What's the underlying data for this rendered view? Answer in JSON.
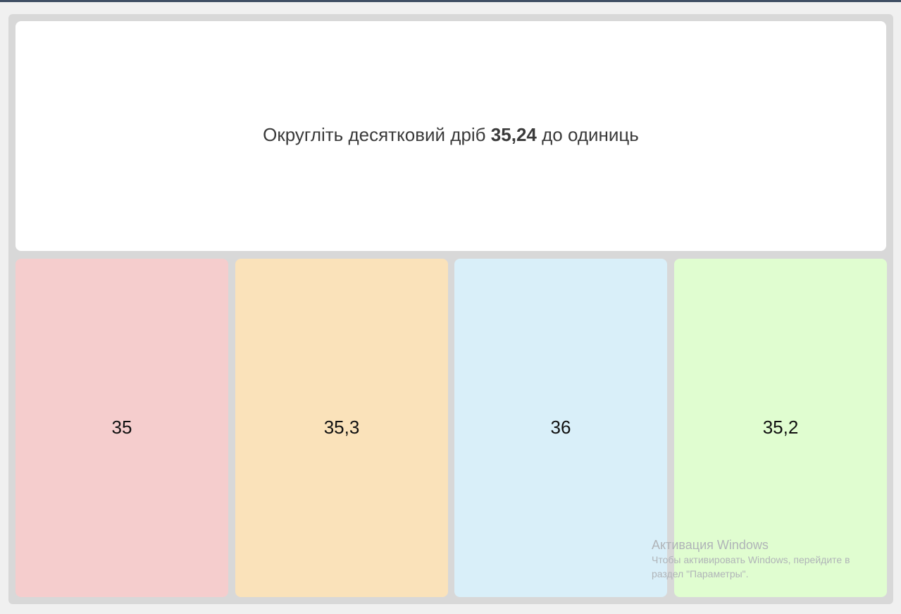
{
  "question": {
    "prefix": "Округліть десятковий дріб ",
    "number": "35,24",
    "suffix": " до одиниць"
  },
  "answers": [
    {
      "label": "35",
      "color": "#f5cdcd"
    },
    {
      "label": "35,3",
      "color": "#fae2ba"
    },
    {
      "label": "36",
      "color": "#d9eff9"
    },
    {
      "label": "35,2",
      "color": "#e0fdd0"
    }
  ],
  "watermark": {
    "title": "Активация Windows",
    "text": "Чтобы активировать Windows, перейдите в раздел \"Параметры\"."
  },
  "colors": {
    "frame": "#d8d8d8",
    "background": "#f0f0f0",
    "topbar": "#3f4e63"
  }
}
